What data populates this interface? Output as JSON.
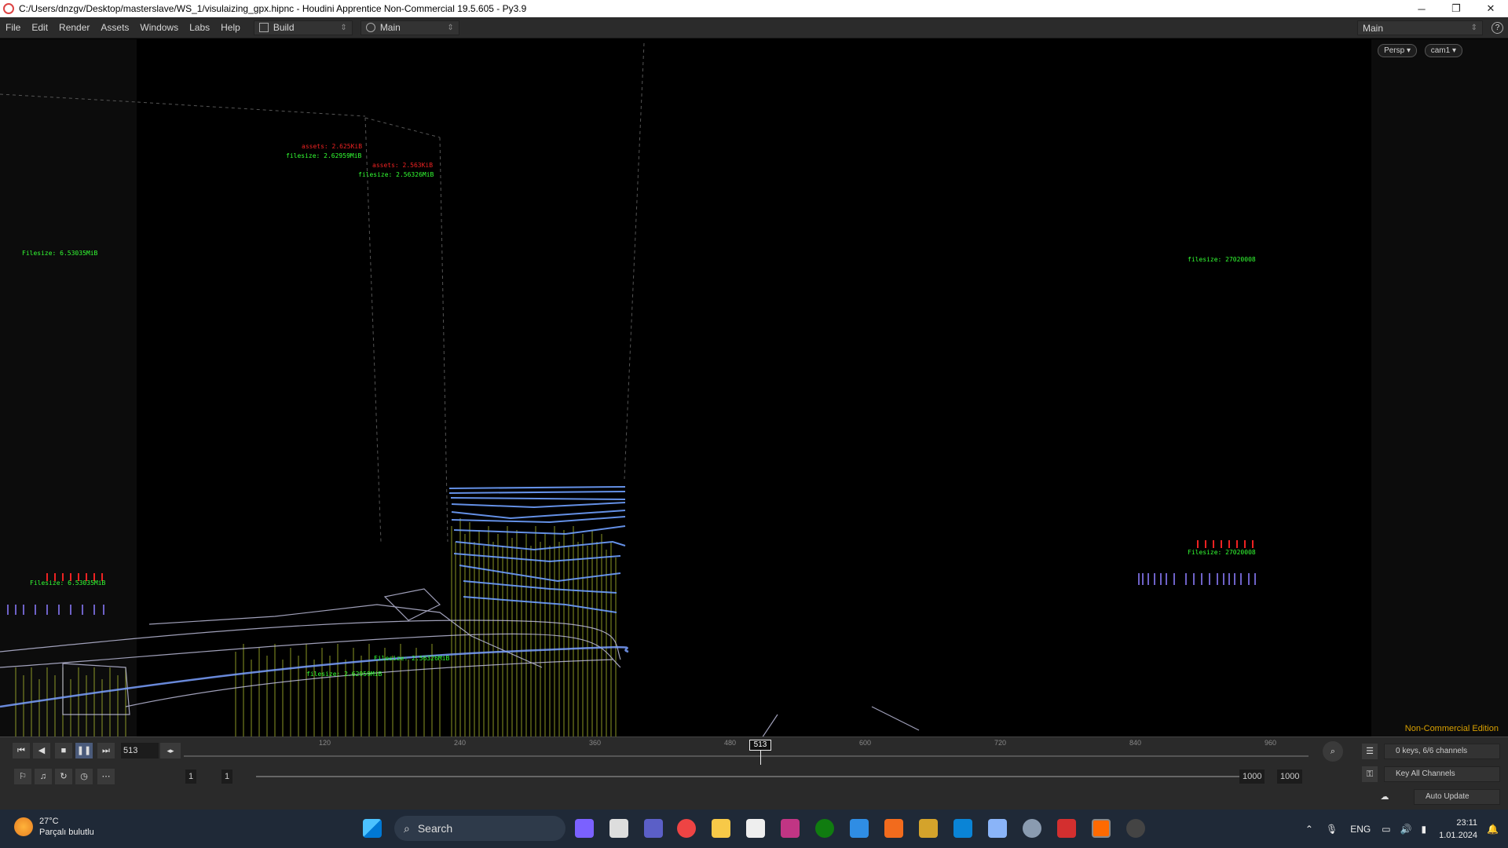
{
  "window": {
    "title": "C:/Users/dnzgv/Desktop/masterslave/WS_1/visulaizing_gpx.hipnc - Houdini Apprentice Non-Commercial 19.5.605 - Py3.9",
    "minimize": "─",
    "restore": "❐",
    "close": "✕"
  },
  "menu": {
    "items": [
      "File",
      "Edit",
      "Render",
      "Assets",
      "Windows",
      "Labs",
      "Help"
    ],
    "desktop_selector": "Build",
    "pane_selector": "Main",
    "right_selector": "Main",
    "help_glyph": "?"
  },
  "viewport": {
    "camera_persp": "Persp ▾",
    "camera_cam": "cam1 ▾",
    "watermark": "Non-Commercial Edition",
    "labels": [
      {
        "cls": "red",
        "text": "assets: 2.625KiB"
      },
      {
        "cls": "green",
        "text": "filesize: 2.62959MiB"
      },
      {
        "cls": "red",
        "text": "assets: 2.563KiB"
      },
      {
        "cls": "green",
        "text": "filesize: 2.56326MiB"
      },
      {
        "cls": "green",
        "text": "Filesize: 6.53035MiB"
      },
      {
        "cls": "green",
        "text": "filesize: 27020008"
      },
      {
        "cls": "green",
        "text": "Filesize: 27020008"
      },
      {
        "cls": "green",
        "text": "Filesize: 6.53035MiB"
      },
      {
        "cls": "green",
        "text": "Filesize: 2.56326MiB"
      },
      {
        "cls": "green",
        "text": "filesize: 2.62959MiB"
      }
    ]
  },
  "playbar": {
    "current_frame": "513",
    "ticks": [
      "120",
      "240",
      "360",
      "480",
      "600",
      "720",
      "840",
      "960"
    ],
    "marker": "513",
    "range_start_a": "1",
    "range_start_b": "1",
    "range_end_a": "1000",
    "range_end_b": "1000",
    "channels": "0 keys, 6/6 channels",
    "key_all": "Key All Channels",
    "auto_update": "Auto Update"
  },
  "taskbar": {
    "temperature": "27°C",
    "weather_desc": "Parçalı bulutlu",
    "search": "Search",
    "language": "ENG",
    "time": "23:11",
    "date": "1.01.2024"
  },
  "colors": {
    "viewport_bg": "#000000",
    "panel_bg": "#2a2a2a",
    "taskbar_bg": "#1f2937",
    "accent_blue": "#6fa0ff",
    "accent_yellow": "#b8c830"
  }
}
